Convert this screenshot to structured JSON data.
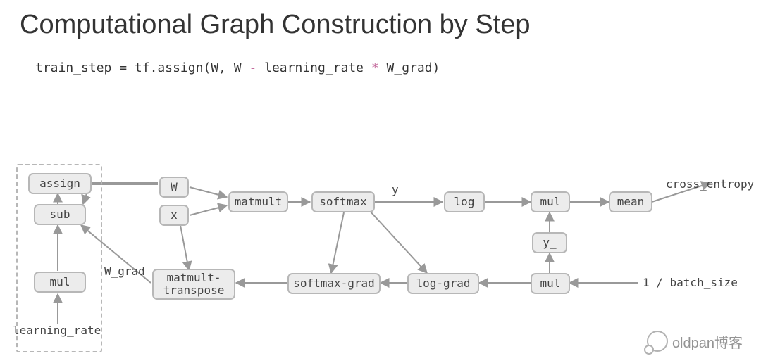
{
  "title": "Computational Graph Construction by Step",
  "code": {
    "var": "train_step",
    "eq": " = ",
    "fn": "tf.assign(W, W ",
    "minus": "-",
    "rest1": " learning_rate ",
    "star": "*",
    "rest2": " W_grad)"
  },
  "nodes": {
    "assign": "assign",
    "sub": "sub",
    "mul_left": "mul",
    "W": "W",
    "x": "x",
    "matmult": "matmult",
    "softmax": "softmax",
    "log": "log",
    "mul_top": "mul",
    "mean": "mean",
    "y_": "y_",
    "matmult_transpose": "matmult-\ntranspose",
    "softmax_grad": "softmax-grad",
    "log_grad": "log-grad",
    "mul_bottom": "mul"
  },
  "labels": {
    "y": "y",
    "cross_entropy": "cross_entropy",
    "w_grad": "W_grad",
    "learning_rate": "learning_rate",
    "batch_size": "1 / batch_size"
  },
  "watermark": "oldpan博客"
}
